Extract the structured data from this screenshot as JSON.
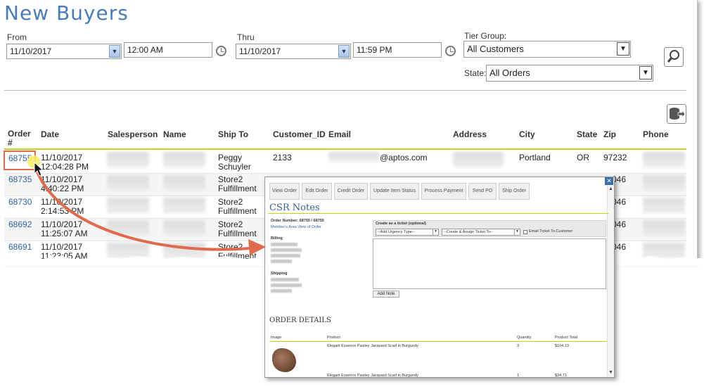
{
  "page": {
    "title": "New Buyers",
    "from_label": "From",
    "from_date": "11/10/2017",
    "from_time": "12:00 AM",
    "thru_label": "Thru",
    "thru_date": "11/10/2017",
    "thru_time": "11:59 PM",
    "tier_group_label": "Tier Group:",
    "tier_group_value": "All Customers",
    "state_label": "State:",
    "state_value": "All Orders"
  },
  "table": {
    "headers": [
      "Order #",
      "Date",
      "Salesperson",
      "Name",
      "Ship To",
      "Customer_ID",
      "Email",
      "Address",
      "City",
      "State",
      "Zip",
      "Phone"
    ],
    "rows": [
      {
        "order": "68755",
        "date1": "11/10/2017",
        "date2": "12:04:28 PM",
        "shipto1": "Peggy",
        "shipto2": "Schuyler",
        "customer_id": "2133",
        "email_domain": "@aptos.com",
        "city": "Portland",
        "state": "OR",
        "zip": "97232"
      },
      {
        "order": "68735",
        "date1": "11/10/2017",
        "date2": "4:40:22 PM",
        "shipto1": "Store2",
        "shipto2": "Fulfillment",
        "customer_id": "",
        "zip": "046"
      },
      {
        "order": "68730",
        "date1": "11/10/2017",
        "date2": "2:14:53 PM",
        "shipto1": "Store2",
        "shipto2": "Fulfillment",
        "zip": "046"
      },
      {
        "order": "68692",
        "date1": "11/10/2017",
        "date2": "11:25:07 AM",
        "shipto1": "Store2",
        "shipto2": "Fulfillment",
        "zip": "046"
      },
      {
        "order": "68691",
        "date1": "11/10/2017",
        "date2": "11:23:05 AM",
        "shipto1": "Store2",
        "shipto2": "Fulfillment",
        "zip": "046"
      }
    ]
  },
  "popup": {
    "tabs": [
      "View Order",
      "Edit Order",
      "Credit Order",
      "Update Item Status",
      "Process Payment",
      "Send PO",
      "Ship Order"
    ],
    "csr_title": "CSR Notes",
    "order_number": "Order Number: 68755 / 68755",
    "members_link": "Member's Area View of Order",
    "billing_label": "Billing",
    "shipping_label": "Shipping",
    "ticket_label": "Create as a ticket (optional)",
    "urgency_select": "--Add Urgency Type--",
    "assign_select": "--Create & Assign Ticket To--",
    "email_checkbox_label": "Email Ticket To Customer",
    "add_note_label": "Add Note",
    "order_details_title": "ORDER DETAILS",
    "od_headers": {
      "image": "Image",
      "product": "Product",
      "quantity": "Quantity",
      "total": "Product Total"
    },
    "od_rows": [
      {
        "product": "Elegant Essence Paisley Jacquard Scarf in Burgundy",
        "quantity": "3",
        "total": "$104.13"
      },
      {
        "product": "Elegant Essence Paisley Jacquard Scarf in Burgundy",
        "quantity": "1",
        "total": "$34.71"
      }
    ]
  },
  "colors": {
    "title_blue": "#4a7bb5",
    "link_blue": "#2e5fa3",
    "accent_line": "#c5d21e",
    "callout_red": "#e06a4d"
  }
}
